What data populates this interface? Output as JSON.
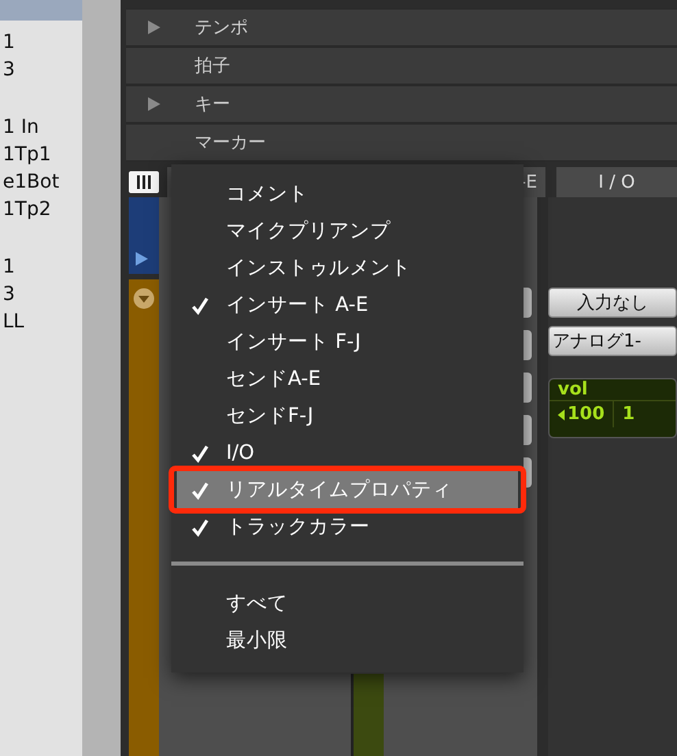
{
  "track_list": {
    "groups": [
      [
        "1",
        "3"
      ],
      [
        "1 In",
        "1Tp1",
        "e1Bot",
        "1Tp2"
      ],
      [
        "1",
        "3",
        "LL"
      ]
    ]
  },
  "rulers": [
    {
      "label": "テンポ",
      "expandable": true
    },
    {
      "label": "拍子",
      "expandable": false
    },
    {
      "label": "キー",
      "expandable": true
    },
    {
      "label": "マーカー",
      "expandable": false
    }
  ],
  "mixer": {
    "column_headers": [
      "-E",
      "I / O"
    ],
    "io": {
      "input": "入力なし",
      "output": "アナログ1-",
      "volume": {
        "label": "vol",
        "value": "100",
        "column_2": "1"
      }
    }
  },
  "menu": {
    "sections": [
      [
        {
          "label": "コメント",
          "checked": false,
          "selected": false
        },
        {
          "label": "マイクプリアンプ",
          "checked": false,
          "selected": false
        },
        {
          "label": "インストゥルメント",
          "checked": false,
          "selected": false
        },
        {
          "label": "インサート A-E",
          "checked": true,
          "selected": false
        },
        {
          "label": "インサート F-J",
          "checked": false,
          "selected": false
        },
        {
          "label": "センドA-E",
          "checked": false,
          "selected": false
        },
        {
          "label": "センドF-J",
          "checked": false,
          "selected": false
        },
        {
          "label": "I/O",
          "checked": true,
          "selected": false
        },
        {
          "label": "リアルタイムプロパティ",
          "checked": true,
          "selected": true
        },
        {
          "label": "トラックカラー",
          "checked": true,
          "selected": false
        }
      ],
      [
        {
          "label": "すべて",
          "checked": false,
          "selected": false
        },
        {
          "label": "最小限",
          "checked": false,
          "selected": false
        }
      ]
    ]
  }
}
